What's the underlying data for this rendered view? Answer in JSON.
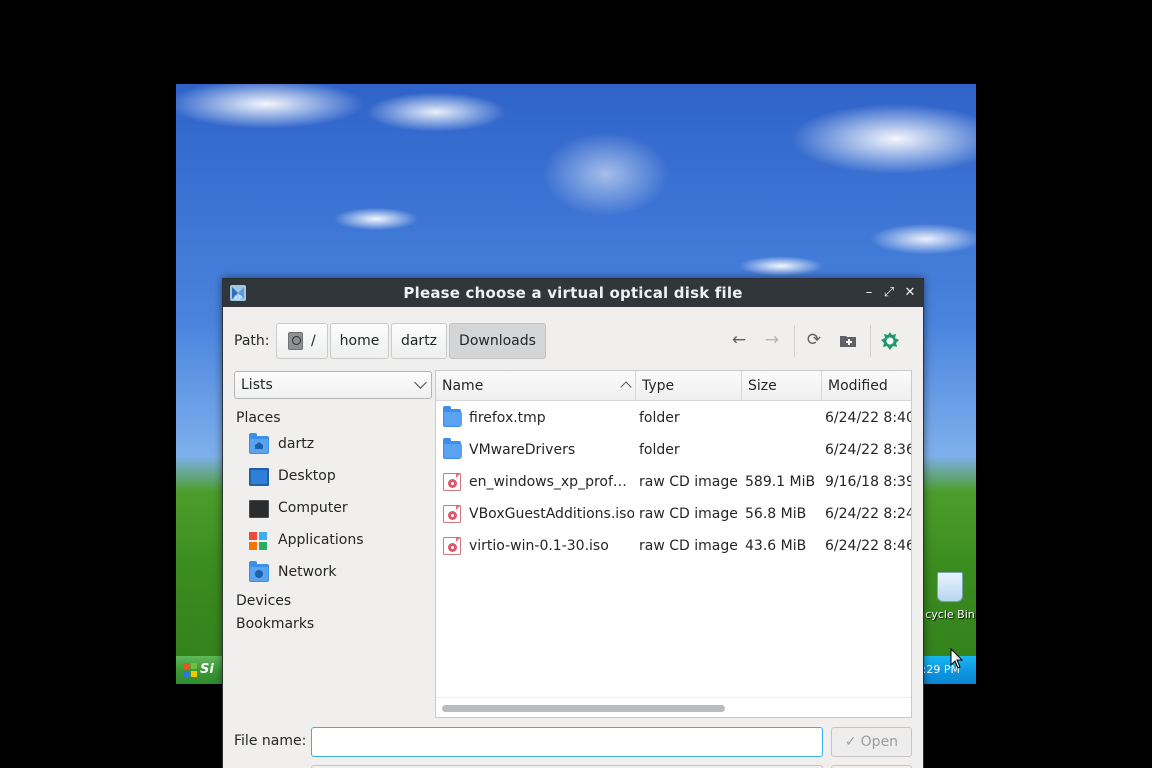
{
  "guest_desktop": {
    "start_label": "Si",
    "recycle_bin_label": "cycle Bin",
    "clock": ":29 PM"
  },
  "dialog": {
    "title": "Please choose a virtual optical disk file",
    "window_buttons": {
      "minimize": "–",
      "maximize": "⤢",
      "close": "✕"
    }
  },
  "path_bar": {
    "label": "Path:",
    "crumbs": [
      "/",
      "home",
      "dartz",
      "Downloads"
    ],
    "active_crumb": "Downloads"
  },
  "toolbar": {
    "back": "←",
    "forward": "→",
    "refresh": "⟳",
    "new_folder": "+"
  },
  "sidebar": {
    "view_mode": "Lists",
    "places_header": "Places",
    "places": [
      {
        "label": "dartz",
        "icon": "home-folder-icon"
      },
      {
        "label": "Desktop",
        "icon": "desktop-icon"
      },
      {
        "label": "Computer",
        "icon": "computer-icon"
      },
      {
        "label": "Applications",
        "icon": "applications-icon"
      },
      {
        "label": "Network",
        "icon": "network-folder-icon"
      }
    ],
    "devices_header": "Devices",
    "bookmarks_header": "Bookmarks"
  },
  "file_list": {
    "columns": [
      "Name",
      "Type",
      "Size",
      "Modified"
    ],
    "sort_column": "Name",
    "rows": [
      {
        "name": "firefox.tmp",
        "type": "folder",
        "size": "",
        "modified": "6/24/22 8:40",
        "icon": "folder-icon"
      },
      {
        "name": "VMwareDrivers",
        "type": "folder",
        "size": "",
        "modified": "6/24/22 8:36",
        "icon": "folder-icon"
      },
      {
        "name": "en_windows_xp_prof…",
        "type": "raw CD image",
        "size": "589.1 MiB",
        "modified": "9/16/18 8:39",
        "icon": "disc-image-icon"
      },
      {
        "name": "VBoxGuestAdditions.iso",
        "type": "raw CD image",
        "size": "56.8 MiB",
        "modified": "6/24/22 8:24",
        "icon": "disc-image-icon"
      },
      {
        "name": "virtio-win-0.1-30.iso",
        "type": "raw CD image",
        "size": "43.6 MiB",
        "modified": "6/24/22 8:46",
        "icon": "disc-image-icon"
      }
    ]
  },
  "footer": {
    "filename_label": "File name:",
    "filename_value": "",
    "open_label": "Open"
  },
  "colors": {
    "titlebar": "#31363b",
    "dialog_bg": "#f0efee",
    "focus_accent": "#3daee9",
    "folder": "#3d8ee6",
    "disc": "#e0566a"
  }
}
